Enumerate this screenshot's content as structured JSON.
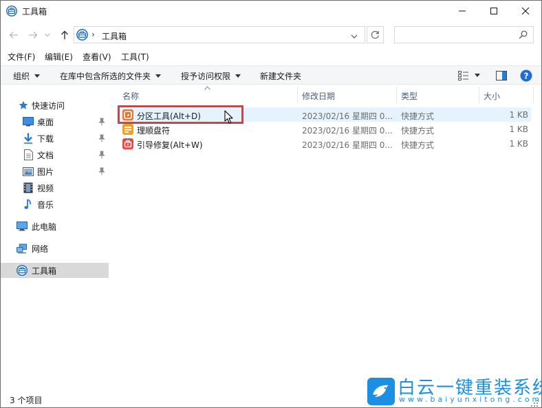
{
  "window": {
    "title": "工具箱",
    "accent": "#0078d7"
  },
  "address": {
    "path": "工具箱",
    "separator": "›",
    "search_placeholder": ""
  },
  "menu": {
    "items": [
      "文件(F)",
      "编辑(E)",
      "查看(V)",
      "工具(T)"
    ]
  },
  "toolbar": {
    "organize": "组织",
    "include_in_library": "在库中包含所选的文件夹",
    "grant_access": "授予访问权限",
    "new_folder": "新建文件夹"
  },
  "sidebar": {
    "quick_access": "快速访问",
    "items": [
      {
        "label": "桌面",
        "icon": "desktop-icon",
        "pinned": true
      },
      {
        "label": "下载",
        "icon": "download-icon",
        "pinned": true
      },
      {
        "label": "文档",
        "icon": "documents-icon",
        "pinned": true
      },
      {
        "label": "图片",
        "icon": "pictures-icon",
        "pinned": true
      },
      {
        "label": "视频",
        "icon": "videos-icon",
        "pinned": false
      },
      {
        "label": "音乐",
        "icon": "music-icon",
        "pinned": false
      }
    ],
    "this_pc": "此电脑",
    "network": "网络",
    "toolbox": "工具箱"
  },
  "columns": {
    "name": "名称",
    "date": "修改日期",
    "type": "类型",
    "size": "大小"
  },
  "files": [
    {
      "name": "分区工具(Alt+D)",
      "date": "2023/02/16 星期四 0...",
      "type": "快捷方式",
      "size": "1 KB",
      "icon_color": "#e8752a"
    },
    {
      "name": "理顺盘符",
      "date": "2023/02/16 星期四 0...",
      "type": "快捷方式",
      "size": "1 KB",
      "icon_color": "#f0a020"
    },
    {
      "name": "引导修复(Alt+W)",
      "date": "2023/02/16 星期四 0...",
      "type": "快捷方式",
      "size": "1 KB",
      "icon_color": "#e84848"
    }
  ],
  "status": {
    "count": "3 个项目"
  },
  "watermark": {
    "title": "白云一键重装系统",
    "url": "www.baiyunxitong.com",
    "color": "#1a8fe3"
  }
}
